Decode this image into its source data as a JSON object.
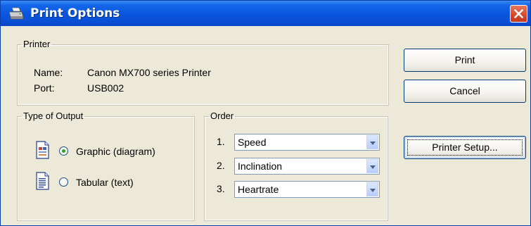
{
  "window": {
    "title": "Print Options"
  },
  "printer": {
    "group_label": "Printer",
    "name_label": "Name:",
    "name_value": "Canon MX700 series Printer",
    "port_label": "Port:",
    "port_value": "USB002"
  },
  "output": {
    "group_label": "Type of Output",
    "options": [
      {
        "label": "Graphic (diagram)",
        "selected": true,
        "icon": "graphic-document-icon"
      },
      {
        "label": "Tabular (text)",
        "selected": false,
        "icon": "text-document-icon"
      }
    ]
  },
  "order": {
    "group_label": "Order",
    "items": [
      {
        "number": "1.",
        "value": "Speed"
      },
      {
        "number": "2.",
        "value": "Inclination"
      },
      {
        "number": "3.",
        "value": "Heartrate"
      }
    ]
  },
  "buttons": {
    "print": "Print",
    "cancel": "Cancel",
    "printer_setup": "Printer Setup..."
  },
  "colors": {
    "titlebar": "#0a55dd",
    "dialog_bg": "#ece9d8",
    "close": "#d5472a",
    "radio_dot": "#2fa12f"
  }
}
